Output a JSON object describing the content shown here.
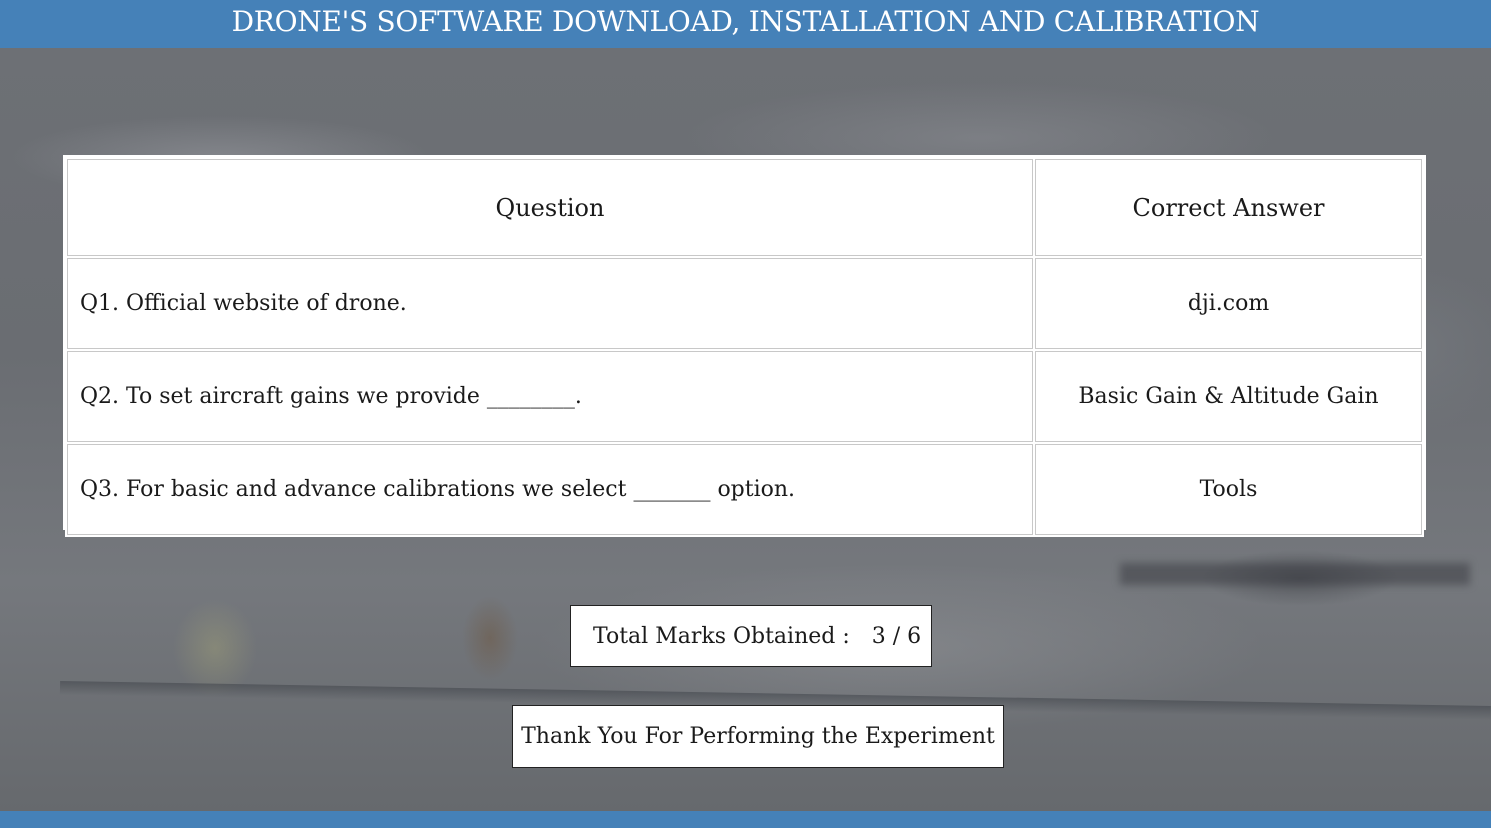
{
  "header": {
    "title": "DRONE'S SOFTWARE DOWNLOAD, INSTALLATION AND CALIBRATION"
  },
  "table": {
    "columns": [
      "Question",
      "Correct Answer"
    ],
    "rows": [
      {
        "question": "Q1. Official website of drone.",
        "answer": "dji.com"
      },
      {
        "question": "Q2. To set aircraft gains we provide ________.",
        "answer": "Basic Gain & Altitude Gain"
      },
      {
        "question": "Q3. For basic and advance calibrations we select _______ option.",
        "answer": "Tools"
      }
    ]
  },
  "result": {
    "label": "Total Marks Obtained :",
    "value": "3 / 6"
  },
  "closing": {
    "message": "Thank You For Performing the Experiment"
  },
  "colors": {
    "header_bg": "#4581b8",
    "header_text": "#ffffff",
    "backdrop": "#6f7276"
  }
}
